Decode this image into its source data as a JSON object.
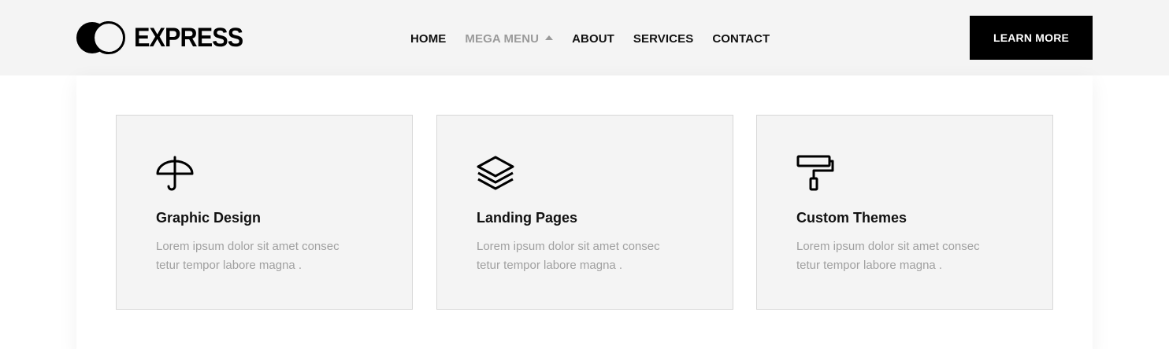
{
  "brand": {
    "name": "EXPRESS"
  },
  "nav": {
    "items": [
      {
        "label": "HOME"
      },
      {
        "label": "MEGA MENU"
      },
      {
        "label": "ABOUT"
      },
      {
        "label": "SERVICES"
      },
      {
        "label": "CONTACT"
      }
    ]
  },
  "cta": {
    "label": "LEARN MORE"
  },
  "cards": [
    {
      "title": "Graphic Design",
      "icon": "umbrella-icon",
      "text": "Lorem ipsum dolor sit amet consec tetur tempor labore magna ."
    },
    {
      "title": "Landing Pages",
      "icon": "layers-icon",
      "text": "Lorem ipsum dolor sit amet consec tetur tempor labore magna ."
    },
    {
      "title": "Custom Themes",
      "icon": "paint-roller-icon",
      "text": "Lorem ipsum dolor sit amet consec tetur tempor labore magna ."
    }
  ],
  "colors": {
    "header_bg": "#f4f4f4",
    "card_bg": "#f4f4f4",
    "cta_bg": "#000000",
    "muted_text": "#a0a0a0"
  }
}
